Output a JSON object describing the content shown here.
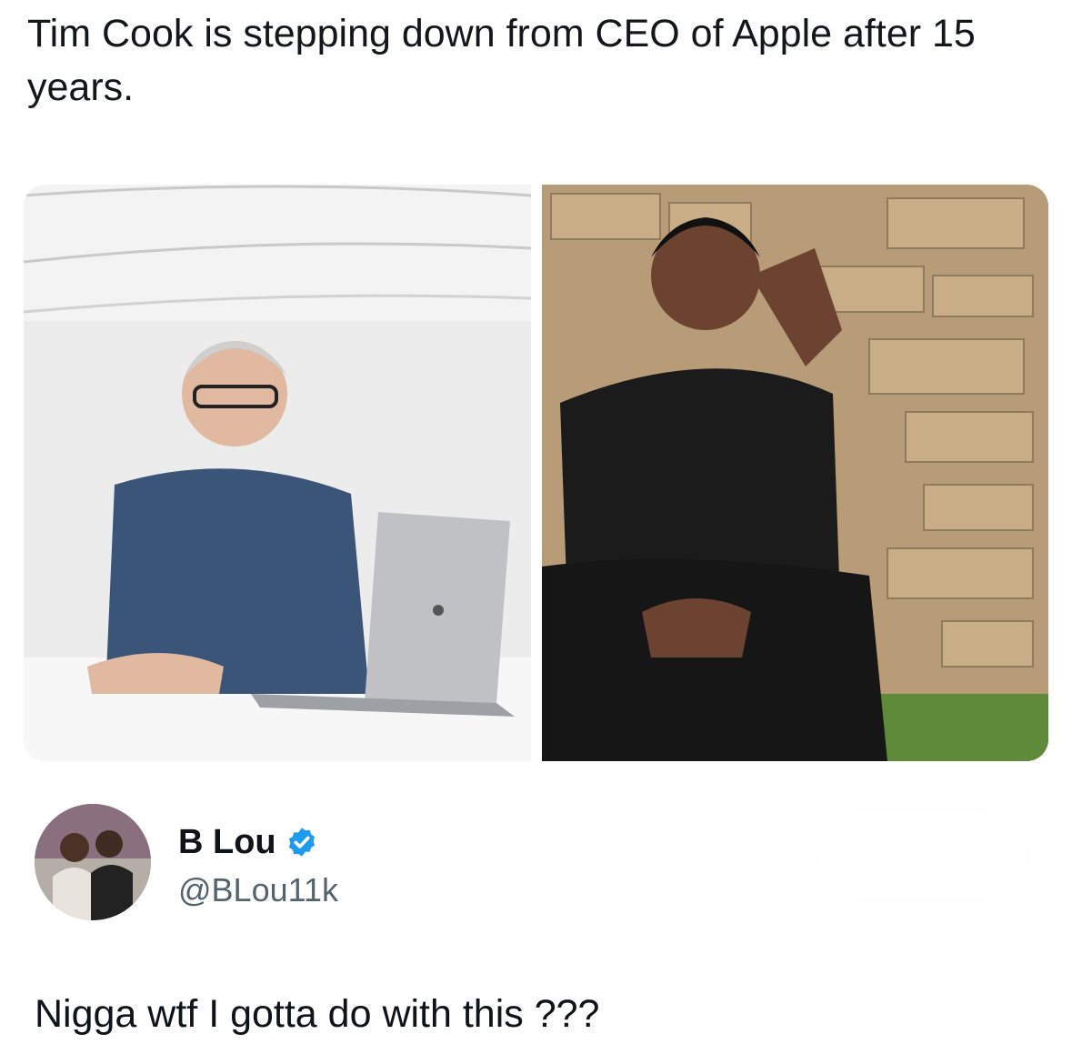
{
  "post": {
    "headline": "Tim Cook is stepping down from CEO of Apple after 15 years."
  },
  "media": {
    "left_image": "photo-man-at-desk-with-laptop",
    "right_image": "photo-young-man-crouching-by-stone-wall"
  },
  "reply": {
    "display_name": "B Lou",
    "handle": "@BLou11k",
    "verified": true,
    "text": "Nigga wtf I gotta do with this ???"
  },
  "colors": {
    "text": "#0f1419",
    "handle": "#536471",
    "verified_badge": "#1d9bf0"
  }
}
